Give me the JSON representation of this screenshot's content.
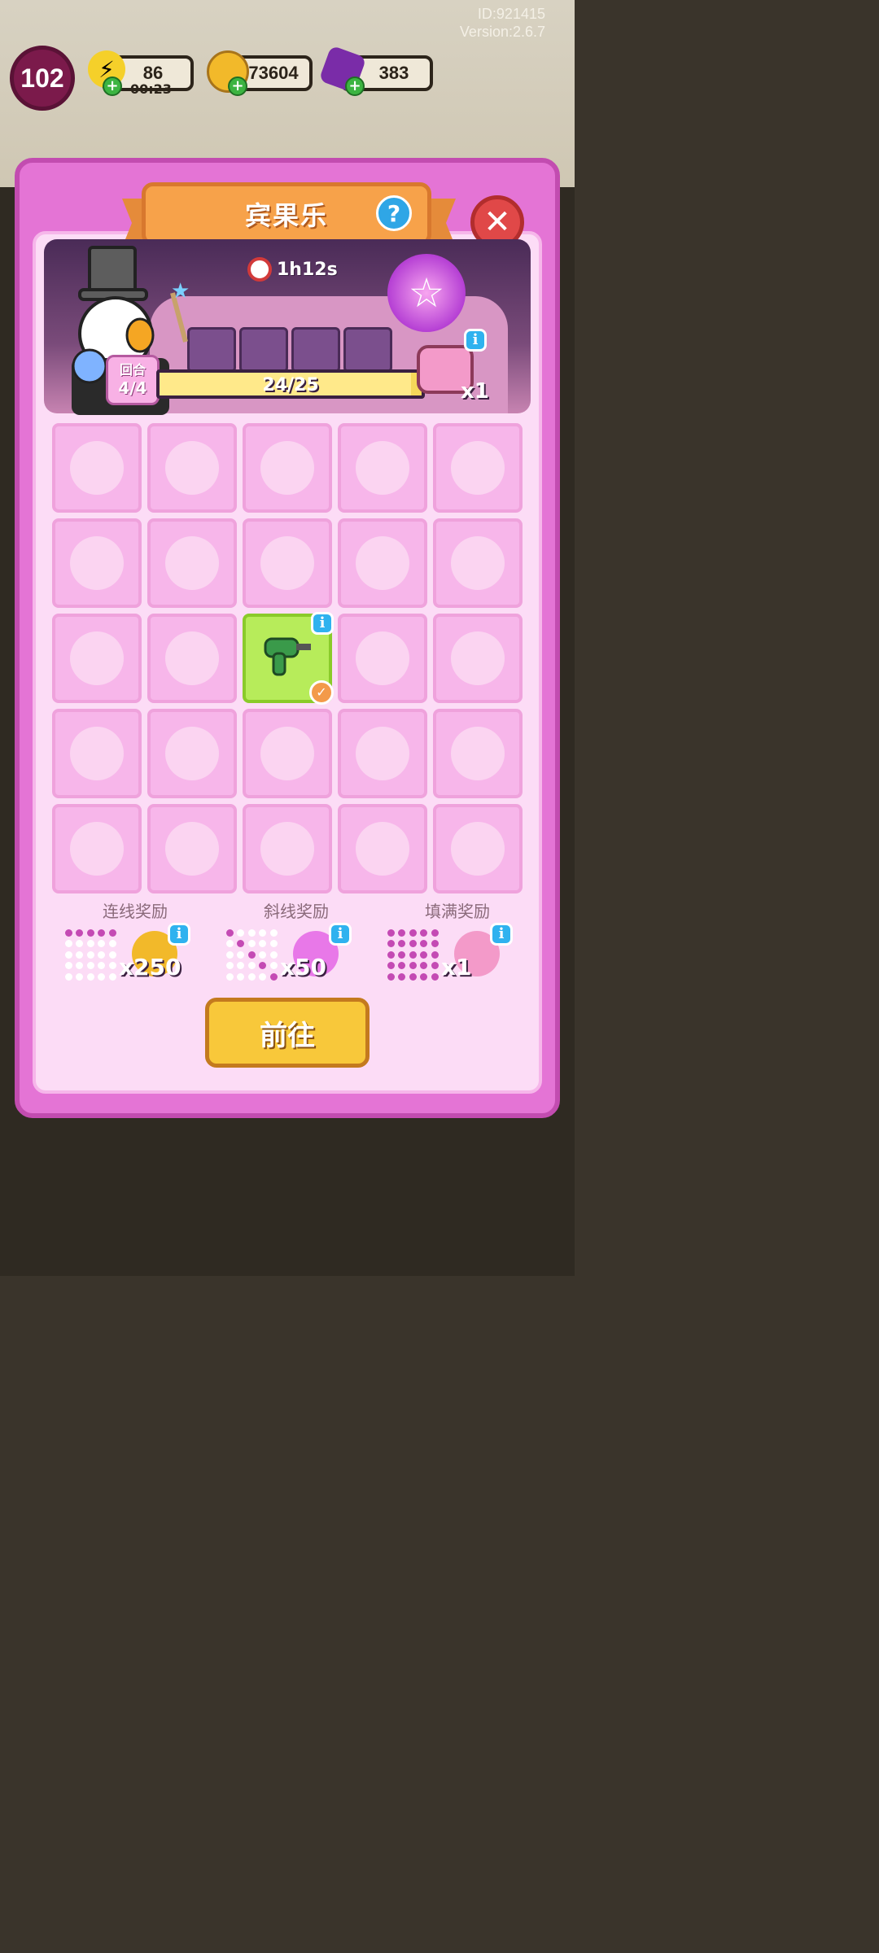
{
  "meta": {
    "id": "ID:921415",
    "version": "Version:2.6.7"
  },
  "hud": {
    "level": "102",
    "energy": "86",
    "energy_timer": "00:23",
    "coins": "73604",
    "gems": "383"
  },
  "dialog": {
    "title": "宾果乐",
    "timer": "1h12s",
    "round_label": "回合",
    "round_value": "4/4",
    "progress_text": "24/25",
    "progress_fraction": 0.96,
    "grand_prize_mult": "x1"
  },
  "grid": {
    "rows": 5,
    "cols": 5,
    "active_cell": {
      "row": 2,
      "col": 2,
      "item": "drill-icon"
    }
  },
  "rewards": [
    {
      "title": "连线奖励",
      "mult": "x250",
      "icon": "coin-icon",
      "pattern": [
        1,
        1,
        1,
        1,
        1,
        0,
        0,
        0,
        0,
        0,
        0,
        0,
        0,
        0,
        0,
        0,
        0,
        0,
        0,
        0,
        0,
        0,
        0,
        0,
        0
      ]
    },
    {
      "title": "斜线奖励",
      "mult": "x50",
      "icon": "gem-flower-icon",
      "pattern": [
        1,
        0,
        0,
        0,
        0,
        0,
        1,
        0,
        0,
        0,
        0,
        0,
        1,
        0,
        0,
        0,
        0,
        0,
        1,
        0,
        0,
        0,
        0,
        0,
        1
      ]
    },
    {
      "title": "填满奖励",
      "mult": "x1",
      "icon": "bag-icon",
      "pattern": [
        1,
        1,
        1,
        1,
        1,
        1,
        1,
        1,
        1,
        1,
        1,
        1,
        1,
        1,
        1,
        1,
        1,
        1,
        1,
        1,
        1,
        1,
        1,
        1,
        1
      ]
    }
  ],
  "go_button": "前往",
  "colors": {
    "panel": "#e474d5",
    "active_cell": "#b7ec5a",
    "button": "#f8c83a"
  }
}
